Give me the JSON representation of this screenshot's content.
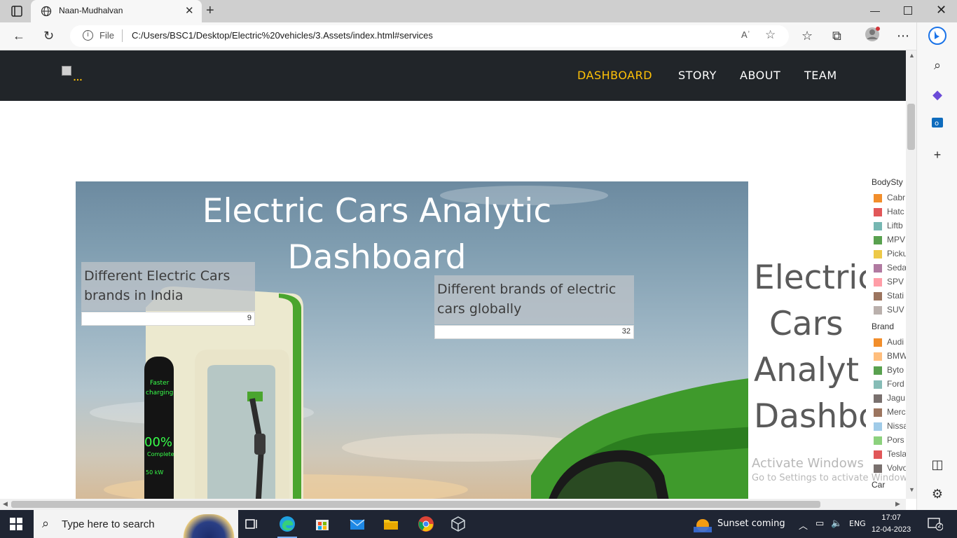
{
  "browser": {
    "tab_title": "Naan-Mudhalvan",
    "address_prefix": "File",
    "url": "C:/Users/BSC1/Desktop/Electric%20vehicles/3.Assets/index.html#services",
    "read_aloud_label": "Aʾ"
  },
  "site": {
    "nav": {
      "items": [
        {
          "label": "DASHBOARD",
          "active": true
        },
        {
          "label": "STORY",
          "active": false
        },
        {
          "label": "ABOUT",
          "active": false
        },
        {
          "label": "TEAM",
          "active": false
        }
      ]
    },
    "accent_color": "#ffc107",
    "navbar_color": "#212529"
  },
  "dashboard": {
    "title": "Electric Cars Analytic Dashboard",
    "kpis": [
      {
        "label": "Different Electric Cars brands in India",
        "value": "9"
      },
      {
        "label": "Different brands of electric cars globally",
        "value": "32"
      }
    ],
    "charger_screen": {
      "line1": "Faster",
      "line2": "charging",
      "percent": "00%",
      "status": "Complete",
      "power": "50 kW"
    },
    "right_title_partial": "Electric Cars Analyt Dashbo",
    "legend": {
      "bodystyle_header": "BodySty",
      "bodystyle_items": [
        {
          "label": "Cabr",
          "color": "#f28e2b"
        },
        {
          "label": "Hatc",
          "color": "#e15759"
        },
        {
          "label": "Liftb",
          "color": "#76b7b2"
        },
        {
          "label": "MPV",
          "color": "#59a14f"
        },
        {
          "label": "Picku",
          "color": "#edc948"
        },
        {
          "label": "Seda",
          "color": "#b07aa1"
        },
        {
          "label": "SPV",
          "color": "#ff9da7"
        },
        {
          "label": "Stati",
          "color": "#9c755f"
        },
        {
          "label": "SUV",
          "color": "#bab0ac"
        }
      ],
      "brand_header": "Brand",
      "brand_items": [
        {
          "label": "Audi",
          "color": "#f28e2b"
        },
        {
          "label": "BMW",
          "color": "#ffbe7d"
        },
        {
          "label": "Byto",
          "color": "#59a14f"
        },
        {
          "label": "Ford",
          "color": "#86bcb6"
        },
        {
          "label": "Jagu",
          "color": "#79706e"
        },
        {
          "label": "Merc",
          "color": "#9c755f"
        },
        {
          "label": "Nissa",
          "color": "#a0cbe8"
        },
        {
          "label": "Pors",
          "color": "#8cd17d"
        },
        {
          "label": "Tesla",
          "color": "#e15759"
        },
        {
          "label": "Volvo",
          "color": "#79706e"
        }
      ],
      "car_header": "Car"
    }
  },
  "watermark": {
    "line1": "Activate Windows",
    "line2": "Go to Settings to activate Windows."
  },
  "taskbar": {
    "search_placeholder": "Type here to search",
    "weather": "Sunset coming",
    "language": "ENG",
    "time": "17:07",
    "date": "12-04-2023",
    "notifications": "2"
  }
}
